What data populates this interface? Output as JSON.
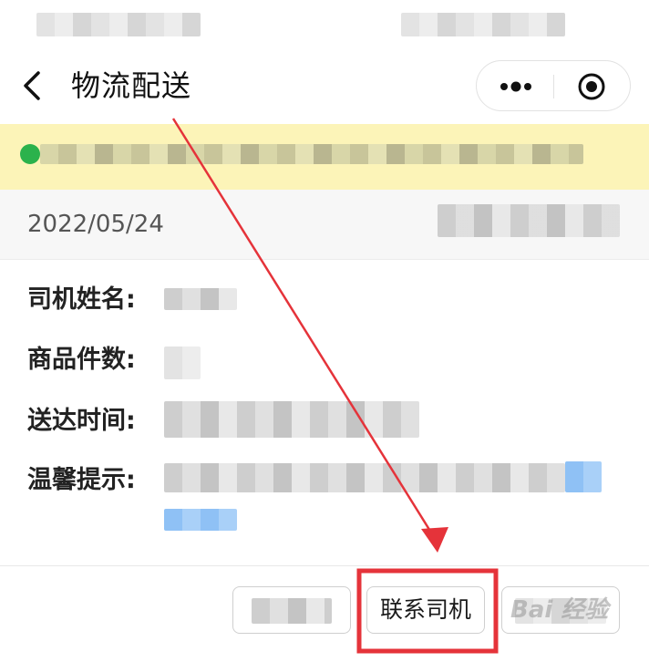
{
  "nav": {
    "title": "物流配送"
  },
  "order": {
    "date": "2022/05/24"
  },
  "details": {
    "driver_name_label": "司机姓名:",
    "item_count_label": "商品件数:",
    "delivery_time_label": "送达时间:",
    "tip_label": "温馨提示:"
  },
  "footer": {
    "contact_driver_label": "联系司机"
  },
  "colors": {
    "notice_bg": "#fcf4b8",
    "notice_icon": "#2bb24c",
    "annotation": "#e5333a"
  }
}
